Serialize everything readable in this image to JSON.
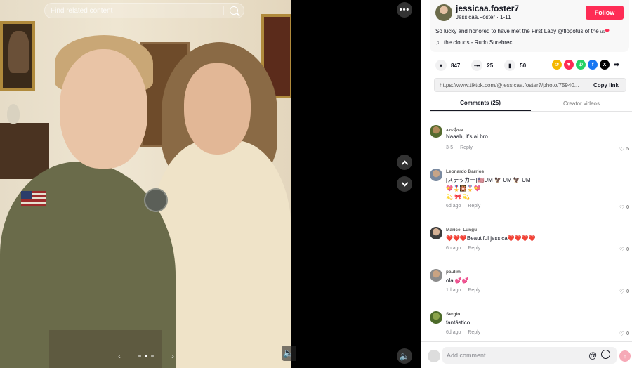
{
  "search": {
    "placeholder": "Find related content"
  },
  "media": {
    "more_icon": "more-horizontal-icon",
    "nav": {
      "up_icon": "chevron-up-icon",
      "down_icon": "chevron-down-icon"
    },
    "volume_icon": "speaker-icon",
    "carousel": {
      "prev": "‹",
      "next": "›",
      "current": 2,
      "total": 3
    }
  },
  "author": {
    "username": "jessicaa.foster7",
    "display_name": "Jessicaa.Foster",
    "date": "1-11",
    "follow_label": "Follow",
    "caption_text": "So lucky and honored to have met the First Lady @flopotus of the ",
    "caption_flag": "us",
    "caption_heart": "❤",
    "music_icon": "♫",
    "music": "the clouds - Rudo Surebrec"
  },
  "stats": {
    "likes": "847",
    "comments": "25",
    "saves": "50"
  },
  "share_icons": [
    "repost-icon",
    "tiktok-share-icon",
    "whatsapp-icon",
    "facebook-icon",
    "x-icon",
    "forward-icon"
  ],
  "link": {
    "url": "https://www.tiktok.com/@jessicaa.foster7/photo/75940...",
    "copy_label": "Copy link"
  },
  "tabs": [
    {
      "label": "Comments (25)"
    },
    {
      "label": "Creator videos"
    }
  ],
  "comments": [
    {
      "user": "ᴀᴢᴇ令ᴇɴ",
      "text": "Naaah, it's ai bro",
      "text2": "",
      "text3": "",
      "time": "3-5",
      "reply": "Reply",
      "likes": "5"
    },
    {
      "user": "Leonardo Barrios",
      "text": "[ステッカー]🇺🇸UM 🦅 UM 🦅 UM",
      "text2": "💝🎖️🎇🎖️💝",
      "text3": "💫 🎀 💫",
      "time": "6d ago",
      "reply": "Reply",
      "likes": "0"
    },
    {
      "user": "Maricel Lungu",
      "text": "❤️❤️❤️Beautiful jessica❤️❤️❤️❤️",
      "text2": "",
      "text3": "",
      "time": "6h ago",
      "reply": "Reply",
      "likes": "0"
    },
    {
      "user": "paulim",
      "text": "ola 💕💕",
      "text2": "",
      "text3": "",
      "time": "1d ago",
      "reply": "Reply",
      "likes": "0"
    },
    {
      "user": "Sergio",
      "text": "fantástico",
      "text2": "",
      "text3": "",
      "time": "6d ago",
      "reply": "Reply",
      "likes": "0"
    }
  ],
  "composer": {
    "placeholder": "Add comment...",
    "at_symbol": "@"
  },
  "colors": {
    "accent": "#fe2c55",
    "text": "#161823",
    "muted": "#8a8b91"
  }
}
